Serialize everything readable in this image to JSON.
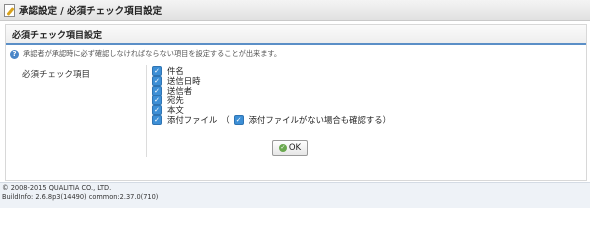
{
  "window": {
    "title": "承認設定 / 必須チェック項目設定"
  },
  "panel": {
    "header": "必須チェック項目設定",
    "info": "承認者が承認時に必ず確認しなければならない項目を設定することが出来ます。",
    "field_label": "必須チェック項目",
    "items": [
      {
        "label": "件名",
        "checked": true
      },
      {
        "label": "送信日時",
        "checked": true
      },
      {
        "label": "送信者",
        "checked": true
      },
      {
        "label": "宛先",
        "checked": true
      },
      {
        "label": "本文",
        "checked": true
      },
      {
        "label": "添付ファイル",
        "checked": true
      }
    ],
    "attachment_open": "（",
    "attachment_sub_label": "添付ファイルがない場合も確認する）",
    "attachment_sub_checked": true,
    "ok_label": "OK"
  },
  "footer": {
    "copyright": "© 2008-2015 QUALITIA CO., LTD.",
    "build": "BuildInfo: 2.6.8p3(14490) common:2.37.0(710)"
  },
  "icons": {
    "title": "document-pen-icon",
    "info": "info-icon",
    "ok": "ok-check-icon"
  },
  "colors": {
    "accent": "#5b8fc7",
    "checkbox": "#3d8fd6",
    "footer_bg": "#eef2f7"
  }
}
